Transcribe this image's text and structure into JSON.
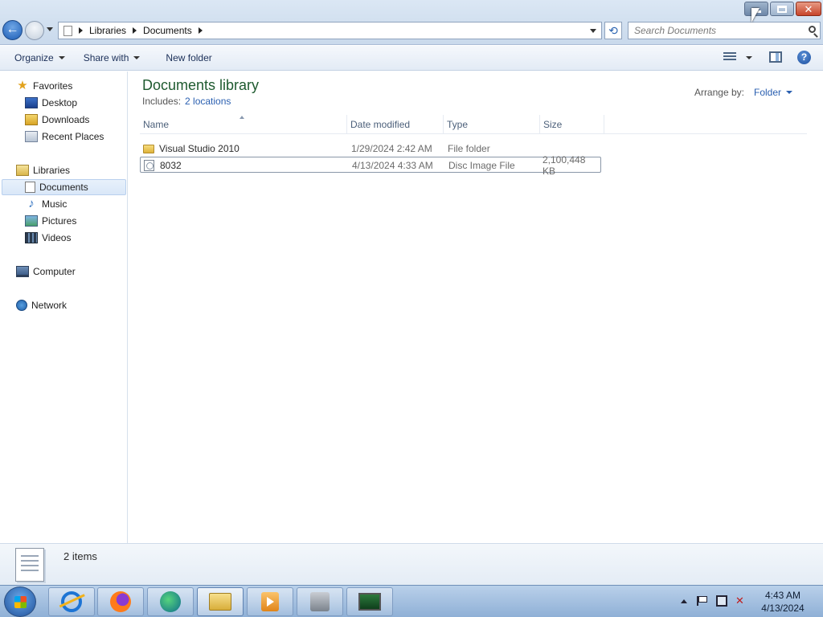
{
  "window": {
    "close_glyph": "✕"
  },
  "address_bar": {
    "crumbs": [
      "Libraries",
      "Documents"
    ],
    "refresh_glyph": "⟲"
  },
  "search": {
    "placeholder": "Search Documents"
  },
  "commands": {
    "organize": "Organize",
    "share_with": "Share with",
    "new_folder": "New folder",
    "help_glyph": "?"
  },
  "nav": {
    "favorites": "Favorites",
    "desktop": "Desktop",
    "downloads": "Downloads",
    "recent_places": "Recent Places",
    "libraries": "Libraries",
    "documents": "Documents",
    "music": "Music",
    "pictures": "Pictures",
    "videos": "Videos",
    "computer": "Computer",
    "network": "Network",
    "star_glyph": "★",
    "music_glyph": "♪"
  },
  "library": {
    "title": "Documents library",
    "includes_label": "Includes:",
    "includes_link": "2 locations",
    "arrange_label": "Arrange by:",
    "arrange_value": "Folder"
  },
  "columns": {
    "name": "Name",
    "date_modified": "Date modified",
    "type": "Type",
    "size": "Size"
  },
  "files": [
    {
      "name": "Visual Studio 2010",
      "date": "1/29/2024 2:42 AM",
      "type": "File folder",
      "size": "",
      "icon": "folder-icon"
    },
    {
      "name": "8032",
      "date": "4/13/2024 4:33 AM",
      "type": "Disc Image File",
      "size": "2,100,448 KB",
      "icon": "disc-image-icon"
    }
  ],
  "details": {
    "count": "2 items"
  },
  "taskbar": {
    "apps": [
      "internet-explorer-icon",
      "firefox-icon",
      "edge-icon",
      "file-explorer-icon",
      "media-player-icon",
      "tools-icon",
      "monitor-icon"
    ],
    "volume_glyph": "✕",
    "time": "4:43 AM",
    "date": "4/13/2024"
  },
  "colors": {
    "title_green": "#1e5a2f",
    "link_blue": "#2a5fb0"
  }
}
